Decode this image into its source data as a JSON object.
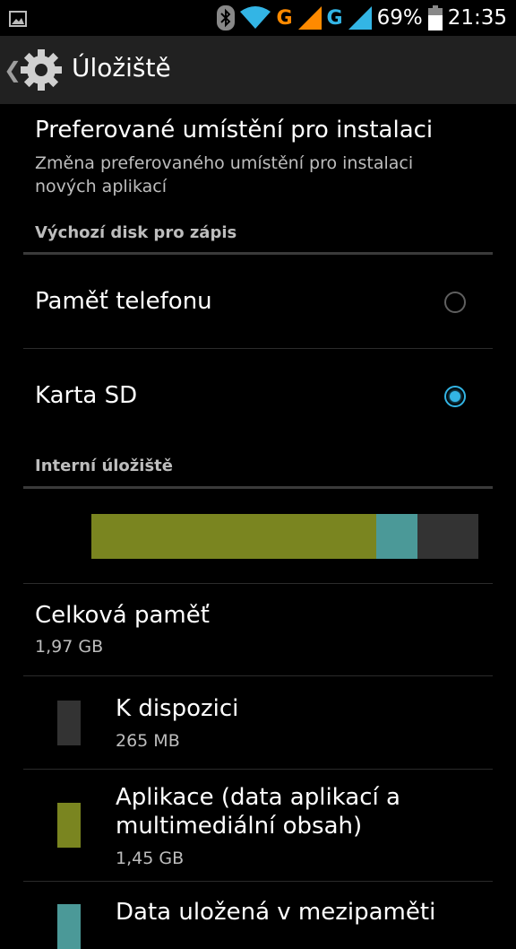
{
  "status_bar": {
    "battery": "69%",
    "time": "21:35",
    "network1": "G",
    "network2": "G",
    "icons": [
      "image-icon",
      "bluetooth-icon",
      "wifi-icon",
      "signal-icon",
      "signal-icon",
      "battery-icon"
    ]
  },
  "action_bar": {
    "title": "Úložiště"
  },
  "install_location": {
    "title": "Preferované umístění pro instalaci",
    "summary_line1": "Změna preferovaného umístění pro instalaci",
    "summary_line2": "nových aplikací"
  },
  "default_write_disk": {
    "header": "Výchozí disk pro zápis",
    "options": [
      {
        "label": "Paměť telefonu",
        "selected": false
      },
      {
        "label": "Karta SD",
        "selected": true
      }
    ]
  },
  "internal_storage": {
    "header": "Interní úložiště",
    "usage_bar": {
      "apps_fraction": 0.736,
      "cache_fraction": 0.107,
      "available_fraction": 0.157
    },
    "total": {
      "title": "Celková paměť",
      "value": "1,97 GB"
    },
    "items": [
      {
        "title": "K dispozici",
        "value": "265 MB",
        "color": "#333333"
      },
      {
        "title_line1": "Aplikace (data aplikací a",
        "title_line2": "multimediální obsah)",
        "value": "1,45 GB",
        "color": "#7a8520"
      },
      {
        "title": "Data uložená v mezipaměti",
        "color": "#4b9998"
      }
    ]
  },
  "colors": {
    "accent": "#33b5e5",
    "apps": "#7a8520",
    "cache": "#4b9998",
    "available": "#333333"
  }
}
